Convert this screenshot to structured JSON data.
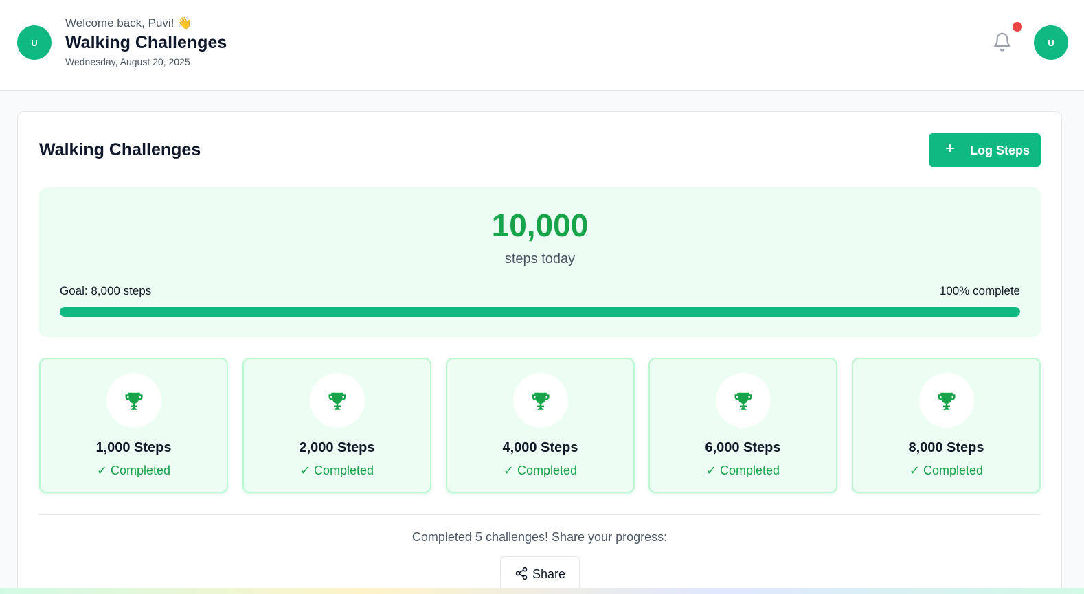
{
  "header": {
    "avatar_initial": "U",
    "welcome": "Welcome back, Puvi! 👋",
    "title": "Walking Challenges",
    "date": "Wednesday, August 20, 2025",
    "profile_initial": "U",
    "notification_icon": "bell-icon"
  },
  "main": {
    "title": "Walking Challenges",
    "log_button": {
      "icon": "+",
      "label": "Log Steps"
    },
    "progress": {
      "steps": "10,000",
      "steps_label": "steps today",
      "goal": "Goal: 8,000 steps",
      "percent_text": "100% complete",
      "percent_value": 100
    },
    "challenges": [
      {
        "title": "1,000 Steps",
        "status": "✓ Completed"
      },
      {
        "title": "2,000 Steps",
        "status": "✓ Completed"
      },
      {
        "title": "4,000 Steps",
        "status": "✓ Completed"
      },
      {
        "title": "6,000 Steps",
        "status": "✓ Completed"
      },
      {
        "title": "8,000 Steps",
        "status": "✓ Completed"
      }
    ],
    "share_text": "Completed 5 challenges! Share your progress:",
    "share_button": "Share"
  },
  "colors": {
    "accent": "#10b981",
    "accent_text": "#16a34a",
    "notification": "#ef4444"
  }
}
